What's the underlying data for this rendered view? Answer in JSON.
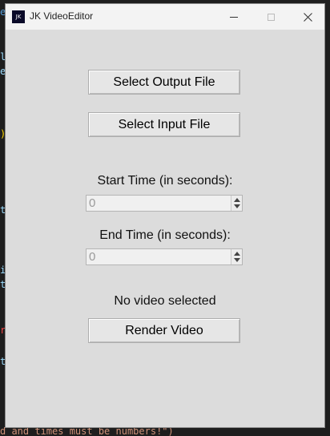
{
  "window": {
    "title": "JK VideoEditor",
    "app_icon_text": "JK"
  },
  "buttons": {
    "select_output": "Select Output File",
    "select_input": "Select Input File",
    "render": "Render Video"
  },
  "start_time": {
    "label": "Start Time (in seconds):",
    "value": "0"
  },
  "end_time": {
    "label": "End Time (in seconds):",
    "value": "0"
  },
  "status": "No video selected",
  "background_code": {
    "bottom_line": "d and times must be numbers!\")"
  }
}
